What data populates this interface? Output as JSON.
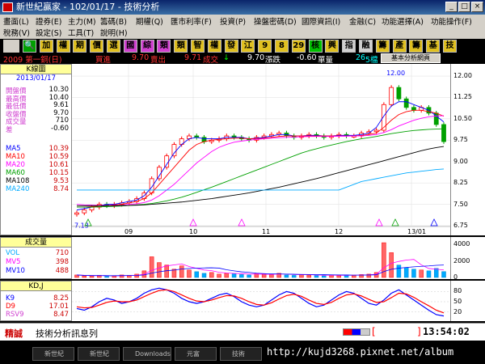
{
  "window": {
    "title": "新世紀贏家 - 102/01/17 - 技術分析"
  },
  "menus": [
    {
      "label": "畫面(L)"
    },
    {
      "label": "證券(E)"
    },
    {
      "label": "主力(M)"
    },
    {
      "label": "籌碼(B)"
    },
    {
      "label": "期權(Q)"
    },
    {
      "label": "匯市利率(F)"
    },
    {
      "label": "投資(P)"
    },
    {
      "label": "操盤密碼(D)"
    },
    {
      "label": "國際資訊(I)"
    },
    {
      "label": "金融(C)"
    },
    {
      "label": "功能選擇(A)"
    },
    {
      "label": "功能操作(F)"
    },
    {
      "label": "稅務(V)"
    },
    {
      "label": "設定(S)"
    },
    {
      "label": "工具(T)"
    },
    {
      "label": "說明(H)"
    }
  ],
  "toolbar": [
    {
      "label": "🔍",
      "icon": "search-icon",
      "bg": "#00a000"
    },
    {
      "label": "加",
      "bg": "#e0c020"
    },
    {
      "label": "權",
      "bg": "#e0c020"
    },
    {
      "label": "期",
      "bg": "#e0c020"
    },
    {
      "label": "價",
      "bg": "#e0c020"
    },
    {
      "label": "選",
      "bg": "#e0c020"
    },
    {
      "label": "國",
      "bg": "#d040d0"
    },
    {
      "label": "綜",
      "bg": "#d040d0"
    },
    {
      "label": "類",
      "bg": "#d040d0"
    },
    {
      "label": "類",
      "bg": "#e0c020"
    },
    {
      "label": "智",
      "bg": "#e0c020"
    },
    {
      "label": "權",
      "bg": "#e0c020"
    },
    {
      "label": "發",
      "bg": "#e0c020"
    },
    {
      "label": "江",
      "bg": "#e0c020"
    },
    {
      "label": "9",
      "bg": "#e0c020"
    },
    {
      "label": "8",
      "bg": "#e0c020"
    },
    {
      "label": "29",
      "bg": "#e0c020"
    },
    {
      "label": "核",
      "bg": "#00c000"
    },
    {
      "label": "興",
      "bg": "#e0c020"
    },
    {
      "label": "指",
      "bg": "#d0d0d0"
    },
    {
      "label": "融",
      "bg": "#d0d0d0"
    },
    {
      "label": "籌",
      "bg": "#e0c020"
    },
    {
      "label": "產",
      "bg": "#e0c020"
    },
    {
      "label": "籌",
      "bg": "#e0c020"
    },
    {
      "label": "基",
      "bg": "#e0c020"
    },
    {
      "label": "技",
      "bg": "#e0c020"
    }
  ],
  "quote": {
    "name": "2009 第一銅(日)",
    "bid_label": "買進",
    "bid": "9.70",
    "ask_label": "賣出",
    "ask": "9.71",
    "last_label": "成交",
    "arrow": "↓",
    "last": "9.70",
    "change_label": "漲跌",
    "change": "-0.60",
    "volume_label": "單量",
    "volume": "26",
    "extra": "5檔",
    "tooltip": "基本分析網頁"
  },
  "left_panel": {
    "title": "K線圖",
    "date": "2013/01/17",
    "rows": [
      {
        "label": "開盤價",
        "value": "10.30",
        "color": "#d040d0"
      },
      {
        "label": "最高價",
        "value": "10.40",
        "color": "#d040d0"
      },
      {
        "label": "最低價",
        "value": "9.61",
        "color": "#d040d0"
      },
      {
        "label": "收盤價",
        "value": "9.70",
        "color": "#d040d0"
      },
      {
        "label": "成交量",
        "value": "710",
        "color": "#d040d0"
      },
      {
        "label": "差",
        "value": "-0.60",
        "color": "#d040d0"
      }
    ],
    "ma": [
      {
        "label": "MA5",
        "value": "10.39",
        "color": "#0000ff"
      },
      {
        "label": "MA10",
        "value": "10.59",
        "color": "#ff0000"
      },
      {
        "label": "MA20",
        "value": "10.61",
        "color": "#ff00ff"
      },
      {
        "label": "MA60",
        "value": "10.15",
        "color": "#00a000"
      },
      {
        "label": "MA108",
        "value": "9.53",
        "color": "#000000"
      },
      {
        "label": "MA240",
        "value": "8.74",
        "color": "#00aaff"
      }
    ]
  },
  "chart_data": [
    {
      "type": "candlestick",
      "title": "",
      "x_ticks": [
        "09",
        "10",
        "11",
        "12",
        "13/01"
      ],
      "y_ticks": [
        "12.00",
        "11.25",
        "10.50",
        "9.75",
        "9.00",
        "8.25",
        "7.50",
        "6.75"
      ],
      "ylim": [
        6.75,
        12.2
      ],
      "annotations": [
        "7.13",
        "12.00"
      ],
      "closes": [
        7.2,
        7.3,
        7.4,
        7.5,
        7.45,
        7.5,
        7.55,
        7.6,
        7.7,
        7.9,
        8.4,
        8.8,
        9.2,
        9.6,
        9.8,
        9.9,
        9.85,
        9.7,
        9.75,
        9.8,
        9.9,
        9.85,
        9.8,
        9.75,
        9.85,
        9.9,
        9.95,
        10.0,
        9.9,
        9.85,
        9.9,
        9.95,
        9.9,
        9.85,
        9.9,
        9.95,
        9.9,
        9.9,
        10.0,
        10.05,
        10.1,
        11.0,
        11.6,
        11.2,
        10.9,
        10.8,
        10.9,
        10.7,
        10.3,
        9.7
      ],
      "series": [
        {
          "name": "MA5",
          "color": "#0000ff",
          "values": [
            7.3,
            7.35,
            7.4,
            7.45,
            7.5,
            7.5,
            7.55,
            7.6,
            7.65,
            7.8,
            8.1,
            8.5,
            8.9,
            9.3,
            9.6,
            9.8,
            9.85,
            9.8,
            9.8,
            9.8,
            9.85,
            9.85,
            9.85,
            9.8,
            9.82,
            9.85,
            9.9,
            9.95,
            9.95,
            9.9,
            9.9,
            9.92,
            9.92,
            9.9,
            9.9,
            9.92,
            9.92,
            9.92,
            9.95,
            10.0,
            10.2,
            10.6,
            10.95,
            11.1,
            11.1,
            11.0,
            10.9,
            10.8,
            10.6,
            10.39
          ]
        },
        {
          "name": "MA10",
          "color": "#ff0000",
          "values": [
            7.4,
            7.4,
            7.42,
            7.44,
            7.46,
            7.48,
            7.5,
            7.55,
            7.6,
            7.7,
            7.9,
            8.2,
            8.5,
            8.8,
            9.1,
            9.4,
            9.6,
            9.7,
            9.75,
            9.78,
            9.8,
            9.82,
            9.82,
            9.8,
            9.8,
            9.82,
            9.85,
            9.88,
            9.9,
            9.9,
            9.9,
            9.9,
            9.9,
            9.9,
            9.9,
            9.9,
            9.9,
            9.9,
            9.92,
            9.95,
            10.0,
            10.2,
            10.45,
            10.65,
            10.75,
            10.8,
            10.8,
            10.75,
            10.7,
            10.59
          ]
        },
        {
          "name": "MA20",
          "color": "#ff00ff",
          "values": [
            7.5,
            7.48,
            7.47,
            7.46,
            7.46,
            7.46,
            7.47,
            7.5,
            7.52,
            7.56,
            7.65,
            7.8,
            8.0,
            8.2,
            8.45,
            8.7,
            8.95,
            9.15,
            9.35,
            9.5,
            9.6,
            9.68,
            9.72,
            9.75,
            9.78,
            9.8,
            9.82,
            9.84,
            9.85,
            9.86,
            9.87,
            9.88,
            9.88,
            9.88,
            9.88,
            9.89,
            9.89,
            9.9,
            9.9,
            9.92,
            9.95,
            10.02,
            10.12,
            10.25,
            10.35,
            10.45,
            10.52,
            10.57,
            10.6,
            10.61
          ]
        },
        {
          "name": "MA60",
          "color": "#00a000",
          "values": [
            7.4,
            7.4,
            7.4,
            7.41,
            7.42,
            7.43,
            7.44,
            7.46,
            7.48,
            7.5,
            7.53,
            7.57,
            7.62,
            7.68,
            7.75,
            7.83,
            7.92,
            8.01,
            8.1,
            8.2,
            8.3,
            8.4,
            8.5,
            8.6,
            8.7,
            8.8,
            8.9,
            9.0,
            9.1,
            9.2,
            9.3,
            9.38,
            9.45,
            9.52,
            9.58,
            9.64,
            9.7,
            9.75,
            9.8,
            9.84,
            9.88,
            9.93,
            9.98,
            10.02,
            10.06,
            10.09,
            10.11,
            10.13,
            10.14,
            10.15
          ]
        },
        {
          "name": "MA108",
          "color": "#000000",
          "values": [
            7.45,
            7.45,
            7.45,
            7.45,
            7.45,
            7.45,
            7.46,
            7.46,
            7.47,
            7.48,
            7.5,
            7.52,
            7.54,
            7.56,
            7.58,
            7.61,
            7.64,
            7.67,
            7.7,
            7.74,
            7.78,
            7.82,
            7.86,
            7.9,
            7.95,
            8.0,
            8.05,
            8.1,
            8.16,
            8.22,
            8.28,
            8.34,
            8.4,
            8.47,
            8.54,
            8.61,
            8.68,
            8.75,
            8.82,
            8.89,
            8.96,
            9.03,
            9.1,
            9.17,
            9.24,
            9.31,
            9.38,
            9.44,
            9.49,
            9.53
          ]
        },
        {
          "name": "MA240",
          "color": "#00aaff",
          "values": [
            8.0,
            8.0,
            8.0,
            8.0,
            8.0,
            8.0,
            8.0,
            8.0,
            8.0,
            8.0,
            8.0,
            8.0,
            8.0,
            8.0,
            8.0,
            8.0,
            8.0,
            8.0,
            8.0,
            8.0,
            8.0,
            8.0,
            8.0,
            8.0,
            8.0,
            8.0,
            8.0,
            8.0,
            8.0,
            8.0,
            8.0,
            8.0,
            8.0,
            8.0,
            8.0,
            8.0,
            8.1,
            8.2,
            8.3,
            8.35,
            8.4,
            8.45,
            8.5,
            8.55,
            8.6,
            8.63,
            8.66,
            8.69,
            8.72,
            8.74
          ]
        }
      ]
    },
    {
      "type": "bar",
      "title": "成交量",
      "y_ticks": [
        "4000",
        "2000",
        "0"
      ],
      "ylim": [
        0,
        4500
      ],
      "series_labels": [
        {
          "label": "VOL",
          "value": "710",
          "color": "#00aaff"
        },
        {
          "label": "MV5",
          "value": "398",
          "color": "#ff00ff"
        },
        {
          "label": "MV10",
          "value": "488",
          "color": "#0000ff"
        }
      ],
      "values": [
        300,
        200,
        180,
        250,
        150,
        200,
        300,
        250,
        400,
        800,
        2500,
        1800,
        1500,
        1000,
        1400,
        900,
        700,
        500,
        600,
        400,
        500,
        450,
        350,
        300,
        450,
        400,
        350,
        500,
        300,
        250,
        350,
        300,
        250,
        200,
        300,
        250,
        300,
        280,
        350,
        400,
        600,
        4200,
        3000,
        1500,
        1200,
        1000,
        900,
        800,
        1100,
        710
      ]
    },
    {
      "type": "line",
      "title": "KD,J",
      "y_ticks": [
        "80",
        "50",
        "20"
      ],
      "ylim": [
        0,
        100
      ],
      "series": [
        {
          "name": "K9",
          "value": "8.25",
          "color": "#0000ff",
          "values": [
            30,
            25,
            35,
            50,
            60,
            55,
            45,
            50,
            60,
            75,
            85,
            90,
            85,
            75,
            60,
            50,
            45,
            50,
            60,
            70,
            75,
            65,
            50,
            40,
            35,
            40,
            55,
            70,
            80,
            75,
            60,
            45,
            35,
            40,
            55,
            70,
            80,
            75,
            60,
            45,
            40,
            55,
            75,
            85,
            70,
            55,
            40,
            25,
            12,
            8
          ]
        },
        {
          "name": "D9",
          "value": "17.01",
          "color": "#ff0000",
          "values": [
            35,
            32,
            33,
            40,
            48,
            52,
            50,
            50,
            55,
            65,
            75,
            83,
            85,
            80,
            70,
            60,
            52,
            50,
            55,
            62,
            68,
            67,
            60,
            50,
            42,
            40,
            47,
            58,
            68,
            72,
            66,
            55,
            45,
            42,
            48,
            60,
            70,
            73,
            67,
            57,
            48,
            50,
            62,
            75,
            73,
            63,
            50,
            38,
            25,
            17
          ]
        }
      ],
      "extra_label": {
        "label": "RSV9",
        "value": "8.47",
        "color": "#d040d0"
      }
    }
  ],
  "status": {
    "left": "精誠",
    "message": "技術分析訊息列",
    "bracket_l": "[",
    "bracket_r": "]",
    "time": "13:54:02"
  },
  "taskbar": {
    "items": [
      {
        "label": "新世紀"
      },
      {
        "label": "新世紀"
      },
      {
        "label": "Downloads"
      },
      {
        "label": "元富"
      },
      {
        "label": "技術"
      }
    ],
    "url": "http://kujd3268.pixnet.net/album"
  }
}
